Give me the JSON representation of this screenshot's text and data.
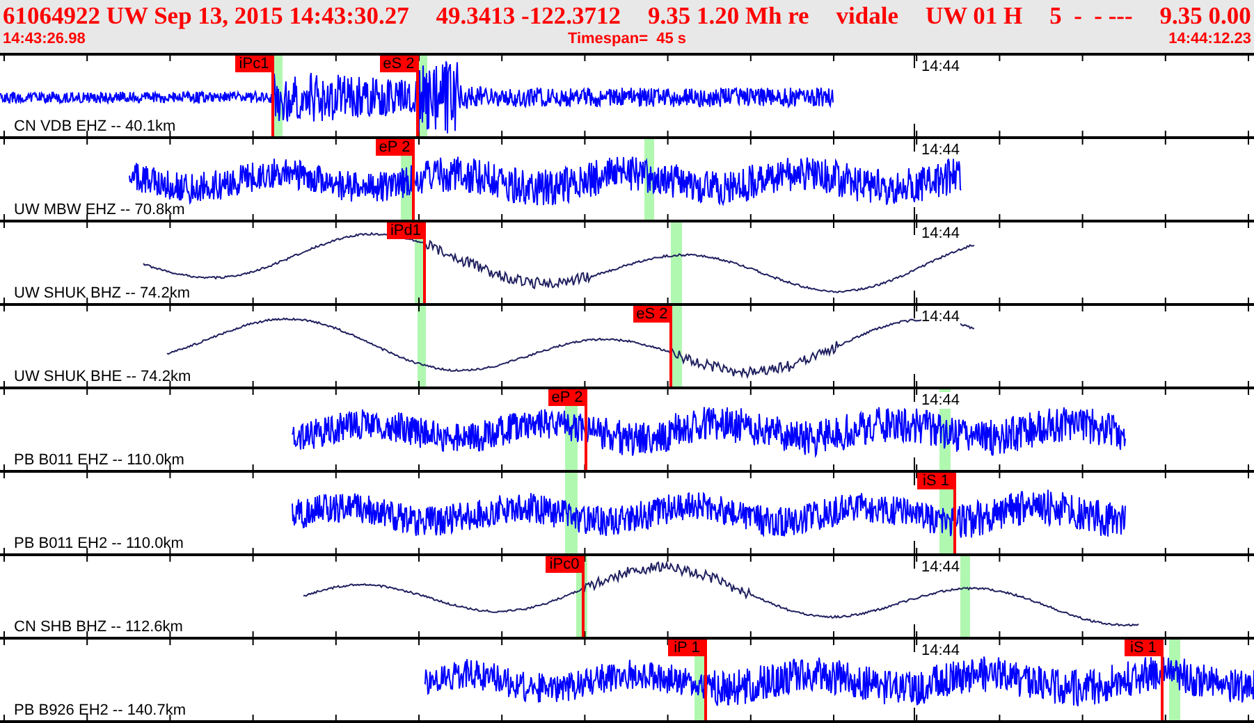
{
  "header": {
    "summary": [
      "61064922 UW Sep 13, 2015 14:43:30.27",
      "49.3413 -122.3712",
      "9.35 1.20 Mh re",
      "vidale",
      "UW 01 H",
      "5  -  - ---",
      "9.35 0.00"
    ],
    "start_time": "14:43:26.98",
    "timespan": "Timespan=  45 s",
    "end_time": "14:44:12.23"
  },
  "traces": [
    {
      "label": "CN VDB EHZ -- 40.1km",
      "kind": "short-period",
      "time_label": "14:44",
      "picks": [
        {
          "label": "iPc1"
        },
        {
          "label": "eS 2"
        }
      ]
    },
    {
      "label": "UW MBW EHZ -- 70.8km",
      "kind": "short-period",
      "time_label": "14:44",
      "picks": [
        {
          "label": "eP 2"
        }
      ]
    },
    {
      "label": "UW SHUK BHZ -- 74.2km",
      "kind": "broadband",
      "time_label": "14:44",
      "picks": [
        {
          "label": "iPd1"
        }
      ]
    },
    {
      "label": "UW SHUK BHE -- 74.2km",
      "kind": "broadband",
      "time_label": "14:44",
      "picks": [
        {
          "label": "eS 2"
        }
      ]
    },
    {
      "label": "PB B011 EHZ -- 110.0km",
      "kind": "short-period",
      "time_label": "14:44",
      "picks": [
        {
          "label": "eP 2"
        }
      ]
    },
    {
      "label": "PB B011 EH2 -- 110.0km",
      "kind": "short-period",
      "picks": [
        {
          "label": "iS 1"
        }
      ]
    },
    {
      "label": "CN SHB BHZ -- 112.6km",
      "kind": "broadband",
      "time_label": "14:44",
      "picks": [
        {
          "label": "iPc0"
        }
      ]
    },
    {
      "label": "PB B926 EH2 -- 140.7km",
      "kind": "short-period",
      "time_label": "14:44",
      "picks": [
        {
          "label": "iP 1"
        },
        {
          "label": "iS 1"
        }
      ]
    }
  ]
}
